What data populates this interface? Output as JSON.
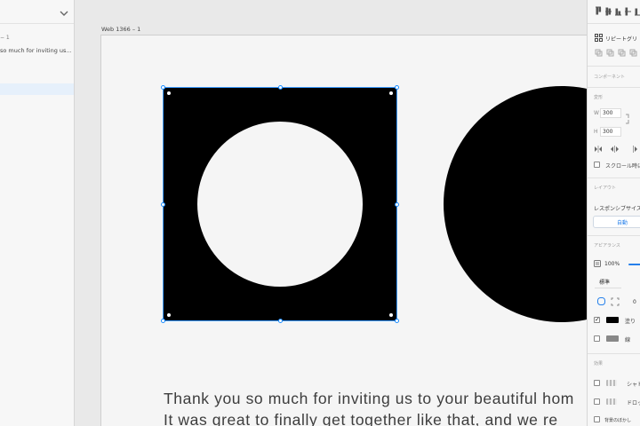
{
  "layers": {
    "entry_dash": "− 1",
    "entry_text": "so much for inviting us..."
  },
  "canvas": {
    "artboard_label": "Web 1366 – 1",
    "body_lines": [
      "Thank you so much for inviting us to your beautiful hom",
      "It was great to finally get together like that, and we re"
    ]
  },
  "inspector": {
    "repeat_grid_label": "リピートグリ",
    "component_section": "コンポーネント",
    "transform_section": "変形",
    "width_label": "W",
    "width_value": "300",
    "height_label": "H",
    "height_value": "300",
    "scroll_label": "スクロール時に",
    "layout_section": "レイアウト",
    "responsive_label": "レスポンシブサイズ",
    "auto_button": "自動",
    "appearance_section": "アピアランス",
    "opacity_value": "100%",
    "blend_mode": "標準",
    "corner_value": "0",
    "fill_label": "塗り",
    "border_label": "線",
    "effects_section": "効果",
    "shadow_label": "シャド",
    "drop_label": "ドロッ",
    "bg_blur_label": "背景のぼかし",
    "fill_color": "#000000",
    "accent_color": "#2680eb"
  }
}
